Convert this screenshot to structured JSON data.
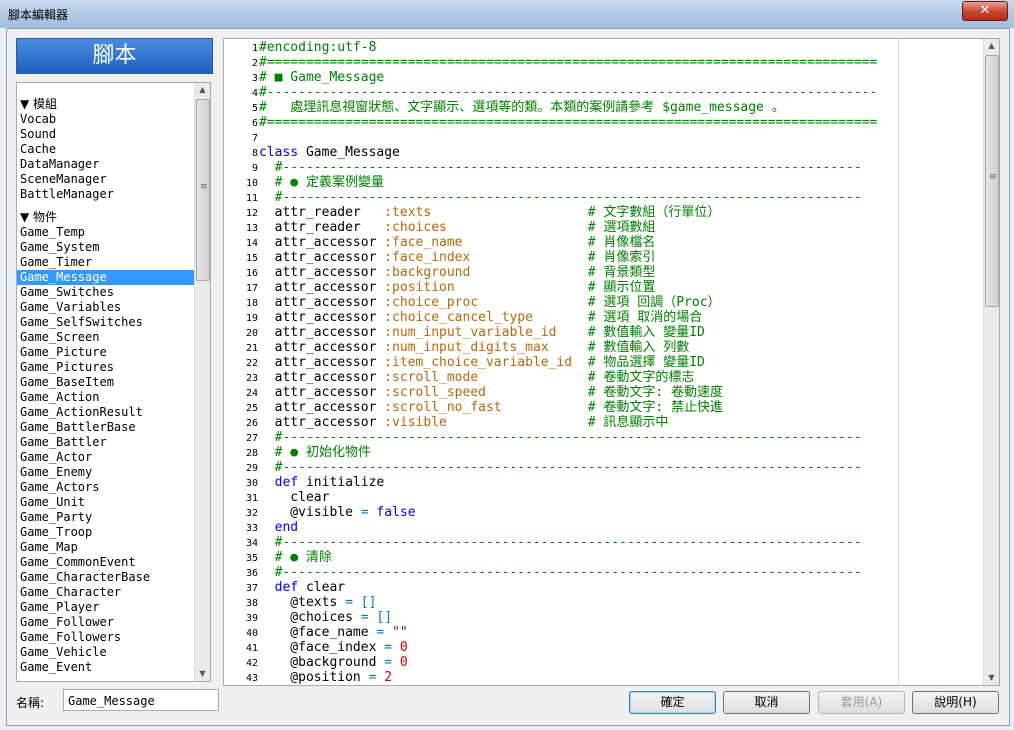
{
  "window": {
    "title": "腳本編輯器",
    "close_label": "✕"
  },
  "sidebar": {
    "header": "腳本",
    "selected": "Game_Message",
    "groups": [
      {
        "label": "▼ 模組",
        "items": [
          "Vocab",
          "Sound",
          "Cache",
          "DataManager",
          "SceneManager",
          "BattleManager"
        ]
      },
      {
        "label": "▼ 物件",
        "items": [
          "Game_Temp",
          "Game_System",
          "Game_Timer",
          "Game_Message",
          "Game_Switches",
          "Game_Variables",
          "Game_SelfSwitches",
          "Game_Screen",
          "Game_Picture",
          "Game_Pictures",
          "Game_BaseItem",
          "Game_Action",
          "Game_ActionResult",
          "Game_BattlerBase",
          "Game_Battler",
          "Game_Actor",
          "Game_Enemy",
          "Game_Actors",
          "Game_Unit",
          "Game_Party",
          "Game_Troop",
          "Game_Map",
          "Game_CommonEvent",
          "Game_CharacterBase",
          "Game_Character",
          "Game_Player",
          "Game_Follower",
          "Game_Followers",
          "Game_Vehicle",
          "Game_Event"
        ]
      }
    ]
  },
  "editor": {
    "lines": [
      [
        [
          "c",
          "#encoding:utf-8"
        ]
      ],
      [
        [
          "c",
          "#=============================================================================="
        ]
      ],
      [
        [
          "c",
          "# ■ Game_Message"
        ]
      ],
      [
        [
          "c",
          "#------------------------------------------------------------------------------"
        ]
      ],
      [
        [
          "c",
          "#   處理訊息視窗狀態、文字顯示、選項等的類。本類的案例請參考 $game_message 。"
        ]
      ],
      [
        [
          "c",
          "#=============================================================================="
        ]
      ],
      [
        [
          "t",
          ""
        ]
      ],
      [
        [
          "k",
          "class"
        ],
        [
          "t",
          " Game_Message"
        ]
      ],
      [
        [
          "c",
          "  #--------------------------------------------------------------------------"
        ]
      ],
      [
        [
          "c",
          "  # ● 定義案例變量"
        ]
      ],
      [
        [
          "c",
          "  #--------------------------------------------------------------------------"
        ]
      ],
      [
        [
          "t",
          "  attr_reader   "
        ],
        [
          "s",
          ":texts"
        ],
        [
          "t",
          "                    "
        ],
        [
          "c",
          "# 文字數組（行單位）"
        ]
      ],
      [
        [
          "t",
          "  attr_reader   "
        ],
        [
          "s",
          ":choices"
        ],
        [
          "t",
          "                  "
        ],
        [
          "c",
          "# 選項數組"
        ]
      ],
      [
        [
          "t",
          "  attr_accessor "
        ],
        [
          "s",
          ":face_name"
        ],
        [
          "t",
          "                "
        ],
        [
          "c",
          "# 肖像檔名"
        ]
      ],
      [
        [
          "t",
          "  attr_accessor "
        ],
        [
          "s",
          ":face_index"
        ],
        [
          "t",
          "               "
        ],
        [
          "c",
          "# 肖像索引"
        ]
      ],
      [
        [
          "t",
          "  attr_accessor "
        ],
        [
          "s",
          ":background"
        ],
        [
          "t",
          "               "
        ],
        [
          "c",
          "# 背景類型"
        ]
      ],
      [
        [
          "t",
          "  attr_accessor "
        ],
        [
          "s",
          ":position"
        ],
        [
          "t",
          "                 "
        ],
        [
          "c",
          "# 顯示位置"
        ]
      ],
      [
        [
          "t",
          "  attr_accessor "
        ],
        [
          "s",
          ":choice_proc"
        ],
        [
          "t",
          "              "
        ],
        [
          "c",
          "# 選項 回調（Proc）"
        ]
      ],
      [
        [
          "t",
          "  attr_accessor "
        ],
        [
          "s",
          ":choice_cancel_type"
        ],
        [
          "t",
          "       "
        ],
        [
          "c",
          "# 選項 取消的場合"
        ]
      ],
      [
        [
          "t",
          "  attr_accessor "
        ],
        [
          "s",
          ":num_input_variable_id"
        ],
        [
          "t",
          "    "
        ],
        [
          "c",
          "# 數值輸入 變量ID"
        ]
      ],
      [
        [
          "t",
          "  attr_accessor "
        ],
        [
          "s",
          ":num_input_digits_max"
        ],
        [
          "t",
          "     "
        ],
        [
          "c",
          "# 數值輸入 列數"
        ]
      ],
      [
        [
          "t",
          "  attr_accessor "
        ],
        [
          "s",
          ":item_choice_variable_id"
        ],
        [
          "t",
          "  "
        ],
        [
          "c",
          "# 物品選擇 變量ID"
        ]
      ],
      [
        [
          "t",
          "  attr_accessor "
        ],
        [
          "s",
          ":scroll_mode"
        ],
        [
          "t",
          "              "
        ],
        [
          "c",
          "# 卷動文字的標志"
        ]
      ],
      [
        [
          "t",
          "  attr_accessor "
        ],
        [
          "s",
          ":scroll_speed"
        ],
        [
          "t",
          "             "
        ],
        [
          "c",
          "# 卷動文字: 卷動速度"
        ]
      ],
      [
        [
          "t",
          "  attr_accessor "
        ],
        [
          "s",
          ":scroll_no_fast"
        ],
        [
          "t",
          "           "
        ],
        [
          "c",
          "# 卷動文字: 禁止快進"
        ]
      ],
      [
        [
          "t",
          "  attr_accessor "
        ],
        [
          "s",
          ":visible"
        ],
        [
          "t",
          "                  "
        ],
        [
          "c",
          "# 訊息顯示中"
        ]
      ],
      [
        [
          "c",
          "  #--------------------------------------------------------------------------"
        ]
      ],
      [
        [
          "c",
          "  # ● 初始化物件"
        ]
      ],
      [
        [
          "c",
          "  #--------------------------------------------------------------------------"
        ]
      ],
      [
        [
          "t",
          "  "
        ],
        [
          "k",
          "def"
        ],
        [
          "t",
          " initialize"
        ]
      ],
      [
        [
          "t",
          "    clear"
        ]
      ],
      [
        [
          "t",
          "    @visible "
        ],
        [
          "o",
          "="
        ],
        [
          "t",
          " "
        ],
        [
          "k",
          "false"
        ]
      ],
      [
        [
          "t",
          "  "
        ],
        [
          "k",
          "end"
        ]
      ],
      [
        [
          "c",
          "  #--------------------------------------------------------------------------"
        ]
      ],
      [
        [
          "c",
          "  # ● 清除"
        ]
      ],
      [
        [
          "c",
          "  #--------------------------------------------------------------------------"
        ]
      ],
      [
        [
          "t",
          "  "
        ],
        [
          "k",
          "def"
        ],
        [
          "t",
          " clear"
        ]
      ],
      [
        [
          "t",
          "    @texts "
        ],
        [
          "o",
          "="
        ],
        [
          "t",
          " "
        ],
        [
          "o",
          "[]"
        ]
      ],
      [
        [
          "t",
          "    @choices "
        ],
        [
          "o",
          "="
        ],
        [
          "t",
          " "
        ],
        [
          "o",
          "[]"
        ]
      ],
      [
        [
          "t",
          "    @face_name "
        ],
        [
          "o",
          "="
        ],
        [
          "t",
          " "
        ],
        [
          "q",
          "\"\""
        ]
      ],
      [
        [
          "t",
          "    @face_index "
        ],
        [
          "o",
          "="
        ],
        [
          "t",
          " "
        ],
        [
          "n",
          "0"
        ]
      ],
      [
        [
          "t",
          "    @background "
        ],
        [
          "o",
          "="
        ],
        [
          "t",
          " "
        ],
        [
          "n",
          "0"
        ]
      ],
      [
        [
          "t",
          "    @position "
        ],
        [
          "o",
          "="
        ],
        [
          "t",
          " "
        ],
        [
          "n",
          "2"
        ]
      ]
    ]
  },
  "footer": {
    "name_label": "名稱:",
    "name_value": "Game_Message",
    "ok": "確定",
    "cancel": "取消",
    "apply": "套用(A)",
    "help": "說明(H)"
  }
}
